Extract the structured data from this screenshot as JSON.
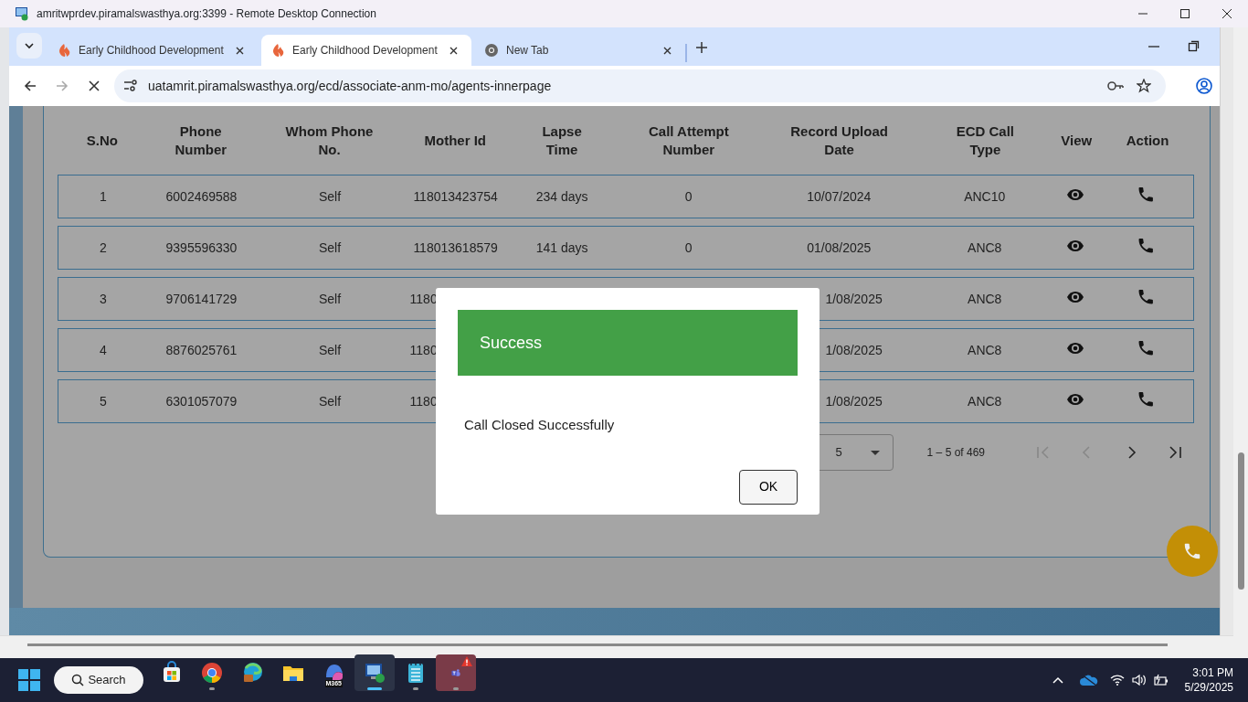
{
  "rdp_window": {
    "title": "amritwprdev.piramalswasthya.org:3399 - Remote Desktop Connection"
  },
  "browser": {
    "tabs": [
      {
        "title": "Early Childhood Development",
        "kind": "app",
        "selected": false
      },
      {
        "title": "Early Childhood Development",
        "kind": "app",
        "selected": true
      },
      {
        "title": "New Tab",
        "kind": "newtab",
        "selected": false
      }
    ],
    "url": "uatamrit.piramalswasthya.org/ecd/associate-anm-mo/agents-innerpage",
    "loading": true
  },
  "table": {
    "columns": [
      "S.No",
      "Phone Number",
      "Whom Phone No.",
      "Mother Id",
      "Lapse Time",
      "Call Attempt Number",
      "Record Upload Date",
      "ECD Call Type",
      "View",
      "Action"
    ],
    "rows": [
      {
        "sno": "1",
        "phone": "6002469588",
        "whom": "Self",
        "mother_id": "118013423754",
        "lapse": "234 days",
        "attempt": "0",
        "upload_date": "10/07/2024",
        "call_type": "ANC10",
        "partly_covered": false
      },
      {
        "sno": "2",
        "phone": "9395596330",
        "whom": "Self",
        "mother_id": "118013618579",
        "lapse": "141 days",
        "attempt": "0",
        "upload_date": "01/08/2025",
        "call_type": "ANC8",
        "partly_covered": false
      },
      {
        "sno": "3",
        "phone": "9706141729",
        "whom": "Self",
        "mother_id": "1180",
        "upload_date": "1/08/2025",
        "call_type": "ANC8",
        "partly_covered": true
      },
      {
        "sno": "4",
        "phone": "8876025761",
        "whom": "Self",
        "mother_id": "1180",
        "upload_date": "1/08/2025",
        "call_type": "ANC8",
        "partly_covered": true
      },
      {
        "sno": "5",
        "phone": "6301057079",
        "whom": "Self",
        "mother_id": "1180",
        "upload_date": "1/08/2025",
        "call_type": "ANC8",
        "partly_covered": true
      }
    ]
  },
  "pagination": {
    "page_size": "5",
    "range": "1 – 5 of 469",
    "buttons": [
      {
        "kind": "first",
        "disabled": true
      },
      {
        "kind": "prev",
        "disabled": true
      },
      {
        "kind": "next",
        "disabled": false
      },
      {
        "kind": "last",
        "disabled": false
      }
    ]
  },
  "dialog": {
    "title": "Success",
    "message": "Call Closed Successfully",
    "button": "OK"
  },
  "taskbar": {
    "search": "Search",
    "apps": [
      {
        "kind": "store",
        "selected": false,
        "running": false
      },
      {
        "kind": "chrome",
        "selected": false,
        "running": true
      },
      {
        "kind": "edge",
        "selected": false,
        "running": false
      },
      {
        "kind": "explorer",
        "selected": false,
        "running": false
      },
      {
        "kind": "m365",
        "label": "M365",
        "selected": false,
        "running": false
      },
      {
        "kind": "rdp",
        "selected": true,
        "running": true
      },
      {
        "kind": "notepad",
        "selected": false,
        "running": true
      },
      {
        "kind": "teams",
        "selected": false,
        "running": true,
        "alert": true
      }
    ],
    "time": "3:01 PM",
    "date": "5/29/2025"
  }
}
